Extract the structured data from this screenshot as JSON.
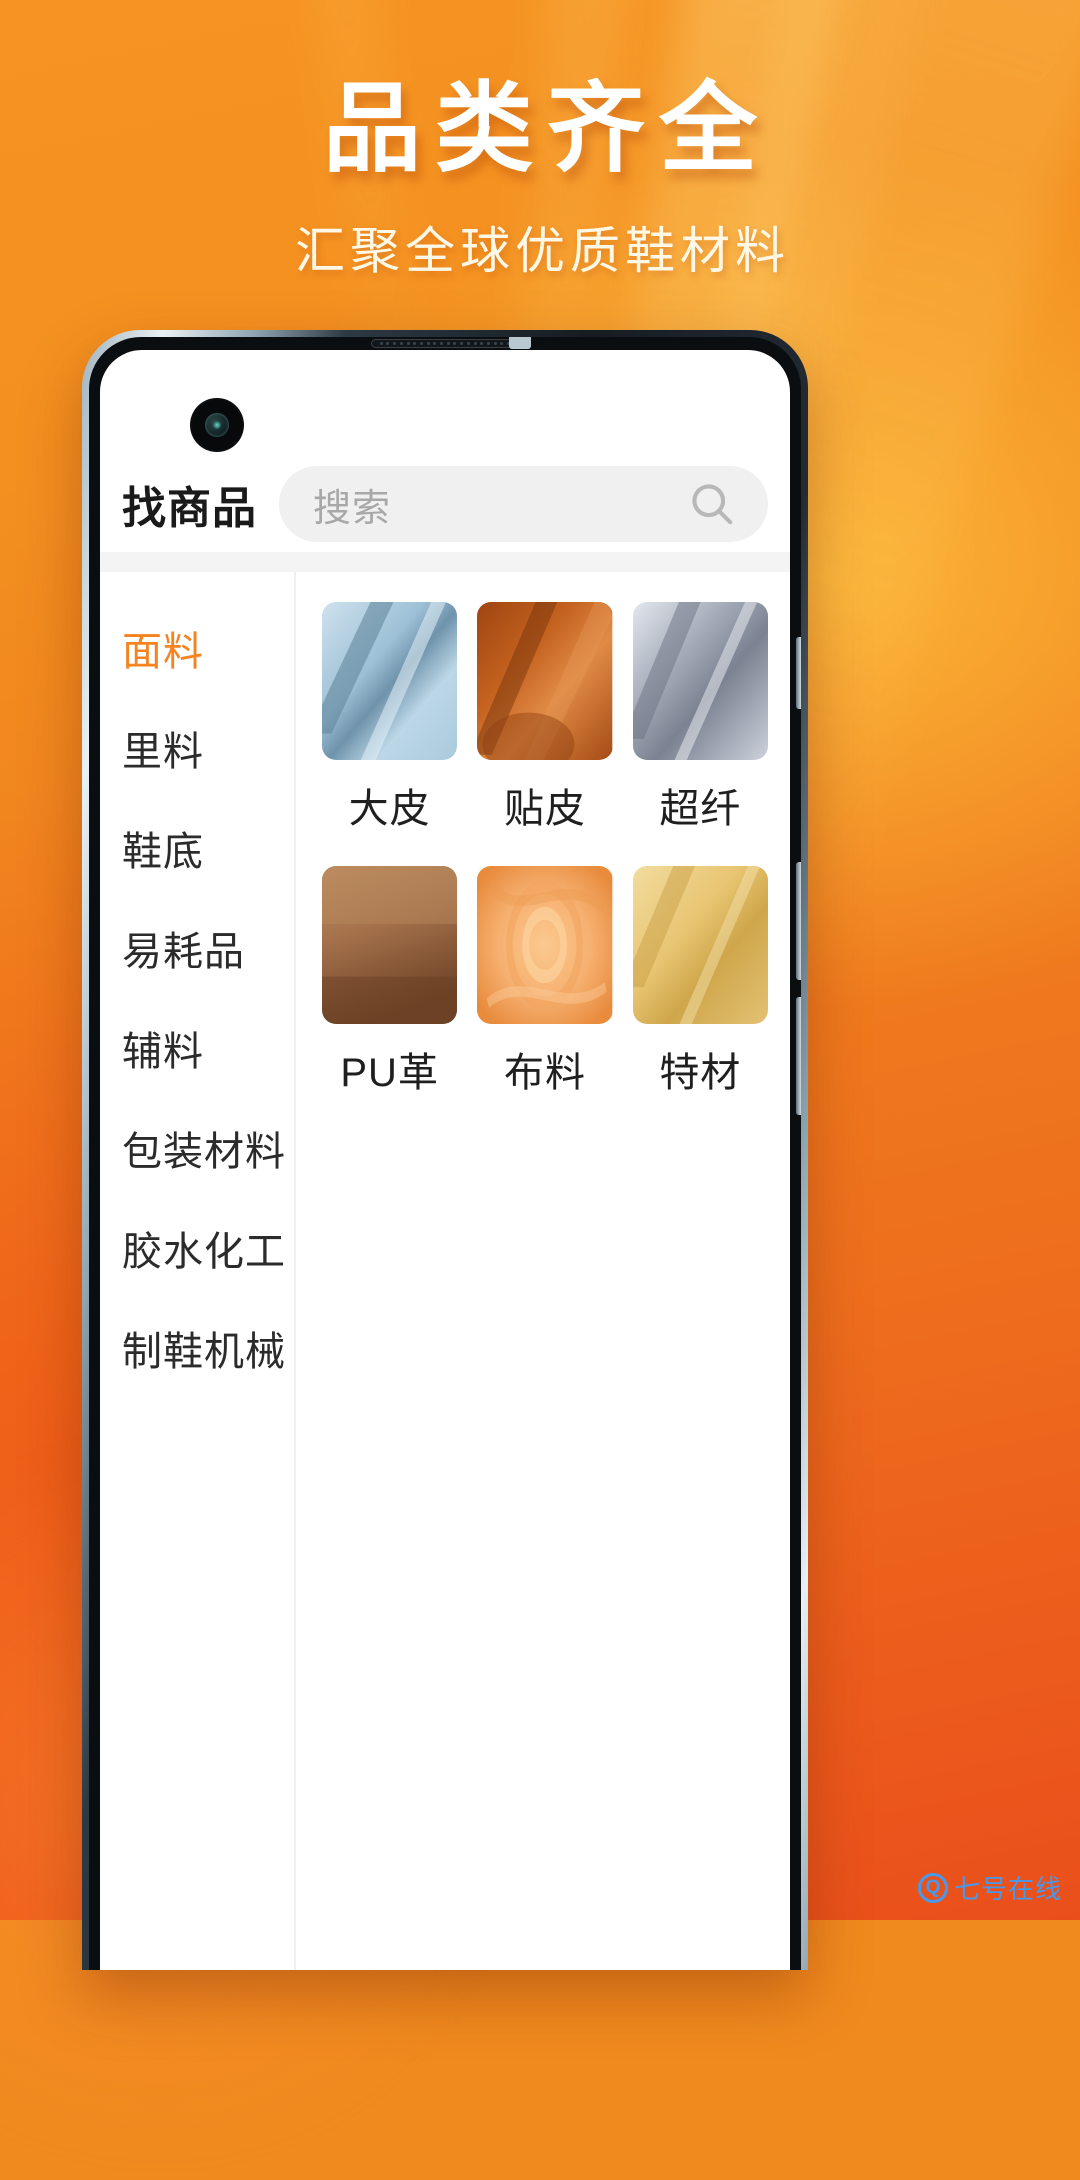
{
  "banner": {
    "headline": "品类齐全",
    "subhead": "汇聚全球优质鞋材料"
  },
  "colors": {
    "accent": "#f58320",
    "bg_top": "#f59422",
    "bg_bottom": "#ea4f1b",
    "headline": "#ffffff",
    "subhead": "#fff8e6",
    "search_bg": "#f0f0f0",
    "watermark": "#3aa0ff"
  },
  "app": {
    "title": "找商品",
    "search": {
      "placeholder": "搜索",
      "value": "",
      "icon": "search-icon"
    },
    "sidebar": {
      "active_index": 0,
      "items": [
        {
          "label": "面料"
        },
        {
          "label": "里料"
        },
        {
          "label": "鞋底"
        },
        {
          "label": "易耗品"
        },
        {
          "label": "辅料"
        },
        {
          "label": "包装材料"
        },
        {
          "label": "胶水化工"
        },
        {
          "label": "制鞋机械"
        }
      ]
    },
    "grid": {
      "items": [
        {
          "label": "大皮",
          "swatch": [
            "#cfe2ee",
            "#9dc0d6",
            "#6f93ab",
            "#bcd7e7"
          ]
        },
        {
          "label": "贴皮",
          "swatch": [
            "#c4621f",
            "#9e4512",
            "#e08a46",
            "#a44c15"
          ]
        },
        {
          "label": "超纤",
          "swatch": [
            "#cdd2dc",
            "#9ba2b0",
            "#7b8291",
            "#bfc5d0"
          ]
        },
        {
          "label": "PU革",
          "swatch": [
            "#a4714b",
            "#7d4f2f",
            "#c08f63",
            "#8a5c3a"
          ]
        },
        {
          "label": "布料",
          "swatch": [
            "#f6b070",
            "#ea9247",
            "#fbc98f",
            "#e88b3d"
          ]
        },
        {
          "label": "特材",
          "swatch": [
            "#e8c572",
            "#cfa64b",
            "#f2dc9e",
            "#d9b059"
          ]
        }
      ]
    }
  },
  "watermark": {
    "badge": "Q",
    "text": "七号在线"
  }
}
